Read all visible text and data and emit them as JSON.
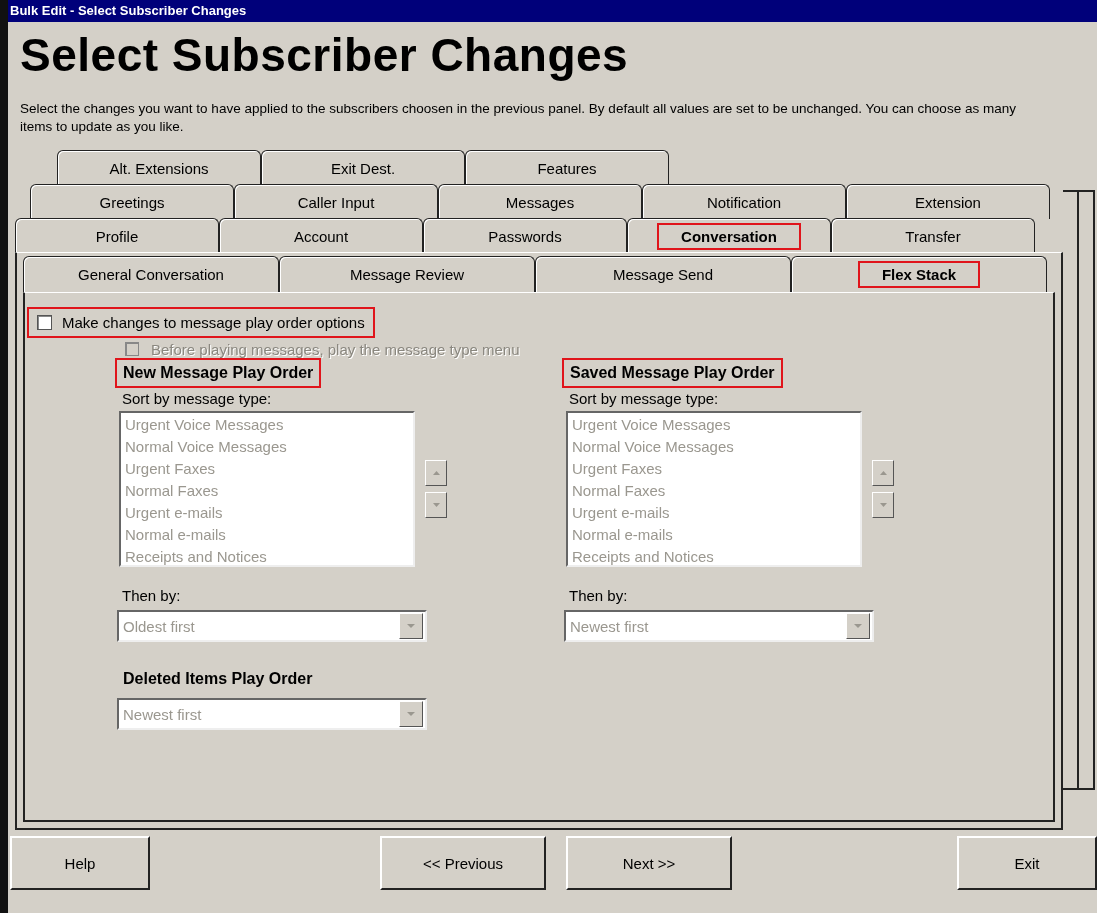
{
  "window": {
    "title": "Bulk Edit - Select Subscriber Changes"
  },
  "heading": "Select Subscriber Changes",
  "description": "Select the changes you want to have applied to the subscribers choosen in the previous panel.  By default all values are set to be unchanged.  You can choose as many items to update as you like.",
  "tab_rows": [
    [
      {
        "label": "Alt. Extensions",
        "selected": false,
        "highlighted": false
      },
      {
        "label": "Exit Dest.",
        "selected": false,
        "highlighted": false
      },
      {
        "label": "Features",
        "selected": false,
        "highlighted": false
      }
    ],
    [
      {
        "label": "Greetings",
        "selected": false,
        "highlighted": false
      },
      {
        "label": "Caller Input",
        "selected": false,
        "highlighted": false
      },
      {
        "label": "Messages",
        "selected": false,
        "highlighted": false
      },
      {
        "label": "Notification",
        "selected": false,
        "highlighted": false
      },
      {
        "label": "Extension",
        "selected": false,
        "highlighted": false
      }
    ],
    [
      {
        "label": "Profile",
        "selected": false,
        "highlighted": false
      },
      {
        "label": "Account",
        "selected": false,
        "highlighted": false
      },
      {
        "label": "Passwords",
        "selected": false,
        "highlighted": false
      },
      {
        "label": "Conversation",
        "selected": true,
        "highlighted": true
      },
      {
        "label": "Transfer",
        "selected": false,
        "highlighted": false
      }
    ]
  ],
  "subtabs": [
    {
      "label": "General Conversation",
      "selected": false,
      "highlighted": false
    },
    {
      "label": "Message Review",
      "selected": false,
      "highlighted": false
    },
    {
      "label": "Message Send",
      "selected": false,
      "highlighted": false
    },
    {
      "label": "Flex Stack",
      "selected": true,
      "highlighted": true
    }
  ],
  "master_option": {
    "label": "Make changes to message play order options",
    "checked": false,
    "highlighted": true
  },
  "menu_option": {
    "label": "Before playing messages, play the message type menu",
    "checked": false,
    "disabled": true
  },
  "sections": [
    {
      "title": "New Message Play Order",
      "highlighted": true,
      "sort_label": "Sort by message type:",
      "items": [
        "Urgent Voice Messages",
        "Normal Voice Messages",
        "Urgent Faxes",
        "Normal Faxes",
        "Urgent e-mails",
        "Normal e-mails",
        "Receipts and Notices"
      ],
      "then_label": "Then by:",
      "then_value": "Oldest first",
      "disabled": true
    },
    {
      "title": "Saved Message Play Order",
      "highlighted": true,
      "sort_label": "Sort by message type:",
      "items": [
        "Urgent Voice Messages",
        "Normal Voice Messages",
        "Urgent Faxes",
        "Normal Faxes",
        "Urgent e-mails",
        "Normal e-mails",
        "Receipts and Notices"
      ],
      "then_label": "Then by:",
      "then_value": "Newest first",
      "disabled": true
    }
  ],
  "deleted": {
    "title": "Deleted Items Play Order",
    "value": "Newest first",
    "disabled": true
  },
  "buttons": [
    "Help",
    "<< Previous",
    "Next >>",
    "Exit"
  ]
}
